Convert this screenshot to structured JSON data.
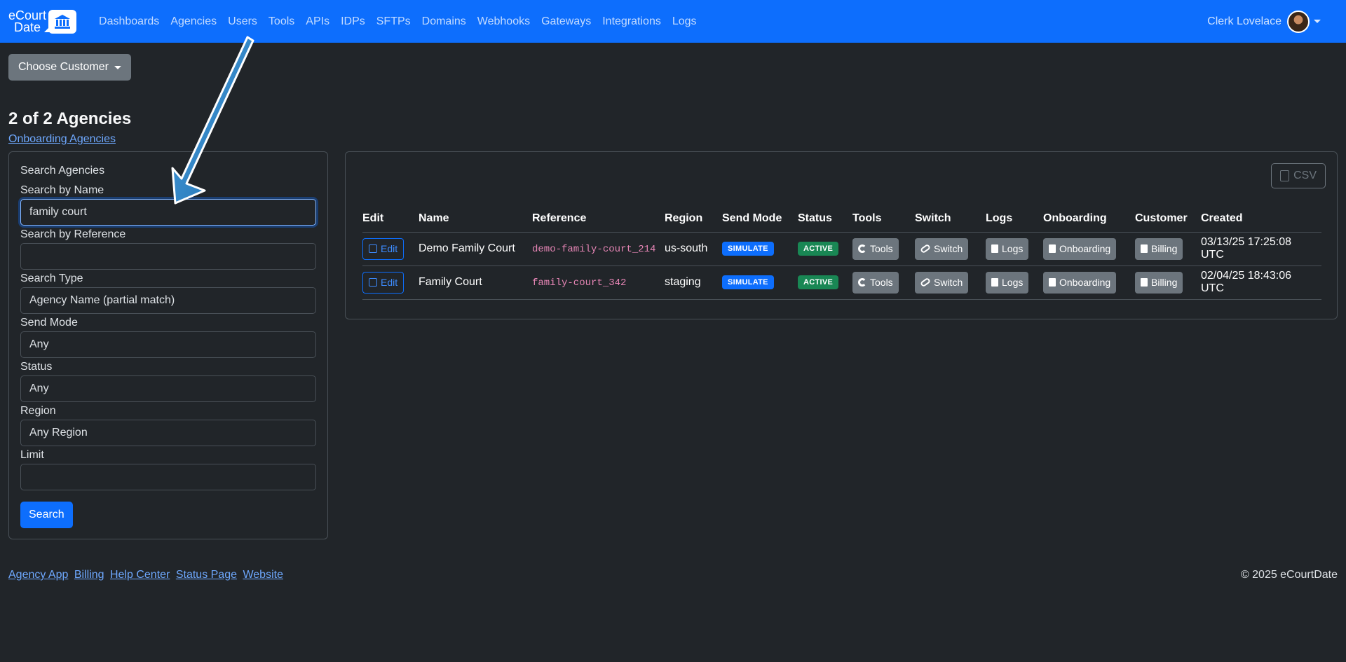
{
  "navbar": {
    "brand_line1": "eCourt",
    "brand_line2": "Date",
    "links": [
      "Dashboards",
      "Agencies",
      "Users",
      "Tools",
      "APIs",
      "IDPs",
      "SFTPs",
      "Domains",
      "Webhooks",
      "Gateways",
      "Integrations",
      "Logs"
    ],
    "user_name": "Clerk Lovelace"
  },
  "choose_customer_label": "Choose Customer",
  "page_title": "2 of 2 Agencies",
  "onboarding_link": "Onboarding Agencies",
  "search": {
    "heading": "Search Agencies",
    "name_label": "Search by Name",
    "name_value": "family court",
    "reference_label": "Search by Reference",
    "reference_value": "",
    "type_label": "Search Type",
    "type_value": "Agency Name (partial match)",
    "send_mode_label": "Send Mode",
    "send_mode_value": "Any",
    "status_label": "Status",
    "status_value": "Any",
    "region_label": "Region",
    "region_value": "Any Region",
    "limit_label": "Limit",
    "limit_value": "",
    "button_label": "Search"
  },
  "results": {
    "csv_label": "CSV",
    "columns": [
      "Edit",
      "Name",
      "Reference",
      "Region",
      "Send Mode",
      "Status",
      "Tools",
      "Switch",
      "Logs",
      "Onboarding",
      "Customer",
      "Created"
    ],
    "rows": [
      {
        "edit": "Edit",
        "name": "Demo Family Court",
        "reference": "demo-family-court_214",
        "region": "us-south",
        "send_mode": "SIMULATE",
        "status": "ACTIVE",
        "tools": "Tools",
        "switch": "Switch",
        "logs": "Logs",
        "onboarding": "Onboarding",
        "customer": "Billing",
        "created": "03/13/25 17:25:08 UTC"
      },
      {
        "edit": "Edit",
        "name": "Family Court",
        "reference": "family-court_342",
        "region": "staging",
        "send_mode": "SIMULATE",
        "status": "ACTIVE",
        "tools": "Tools",
        "switch": "Switch",
        "logs": "Logs",
        "onboarding": "Onboarding",
        "customer": "Billing",
        "created": "02/04/25 18:43:06 UTC"
      }
    ]
  },
  "footer": {
    "links": [
      "Agency App",
      "Billing",
      "Help Center",
      "Status Page",
      "Website"
    ],
    "copyright": "© 2025 eCourtDate"
  },
  "colors": {
    "navbar": "#0d6efd",
    "background": "#212529",
    "annotation_arrow": "#2e86c9"
  }
}
